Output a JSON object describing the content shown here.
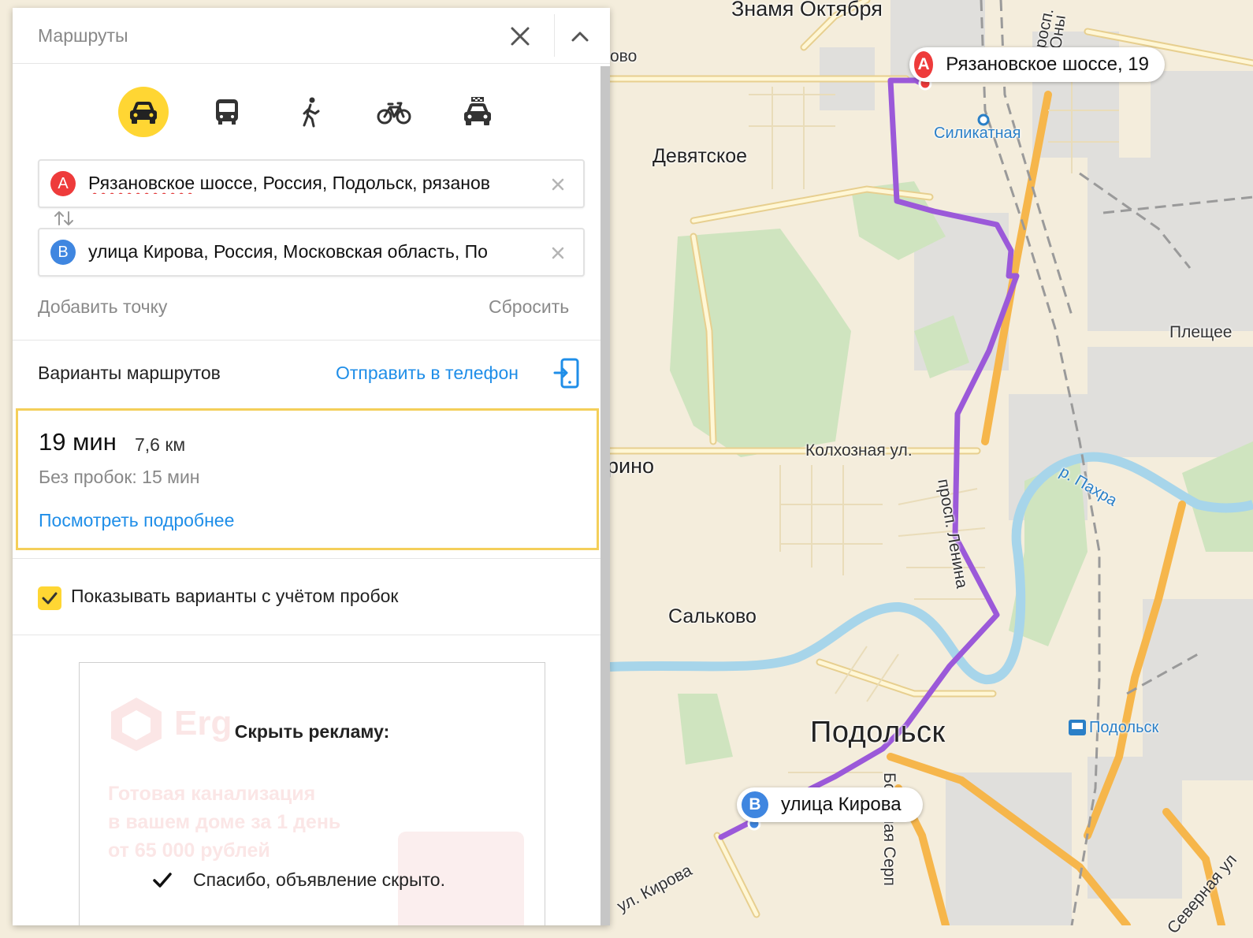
{
  "panel": {
    "title": "Маршруты",
    "modes": [
      {
        "name": "car",
        "active": true
      },
      {
        "name": "bus",
        "active": false
      },
      {
        "name": "walk",
        "active": false
      },
      {
        "name": "bicycle",
        "active": false
      },
      {
        "name": "taxi",
        "active": false
      }
    ],
    "point_a": {
      "letter": "A",
      "prefix": "Рязановское",
      "rest": " шоссе, Россия, Подольск, рязанов"
    },
    "point_b": {
      "letter": "B",
      "value": "улица Кирова, Россия, Московская область, По"
    },
    "add_point": "Добавить точку",
    "reset": "Сбросить",
    "variants_title": "Варианты маршрутов",
    "send_to_phone": "Отправить в телефон",
    "route": {
      "time": "19 мин",
      "distance": "7,6 км",
      "no_traffic": "Без пробок: 15 мин",
      "details": "Посмотреть подробнее"
    },
    "traffic_option": {
      "label": "Показывать варианты с учётом пробок",
      "checked": true
    },
    "ad": {
      "hide_title": "Скрыть рекламу:",
      "thanks": "Спасибо, объявление скрыто.",
      "ghost_brand": "Erg",
      "ghost_lines": [
        "Готовая канализация",
        "в вашем доме за 1 день",
        "от 65 000 рублей"
      ]
    }
  },
  "map": {
    "pin_a_label": "Рязановское шоссе, 19",
    "pin_b_label": "улица Кирова",
    "labels": {
      "znamya": "Знамя Октября",
      "vo": "ово",
      "silikatnaya": "Силикатная",
      "devyatskoe": "Девятское",
      "pleshe": "Плещее",
      "kolkhoznaya": "Колхозная ул.",
      "erino": "Ерино",
      "pakhra": "р. Пахра",
      "salkovo": "Сальково",
      "podolsk": "Подольск",
      "podolsk_station": "Подольск",
      "kirova_street": "ул. Кирова",
      "prospekt_top": "просп.",
      "prospekt_lenina": "просп. Ленина",
      "bolshaya_serp": "Большая Серп",
      "severnaya": "Северная ул",
      "ony": "Оны"
    },
    "colors": {
      "route": "#9b59d9",
      "water": "#a7d5ea",
      "greenery": "#cfe4bf",
      "industrial": "#dcdcdc",
      "major_road": "#f6b64b",
      "minor_road": "#fff7d6"
    }
  }
}
